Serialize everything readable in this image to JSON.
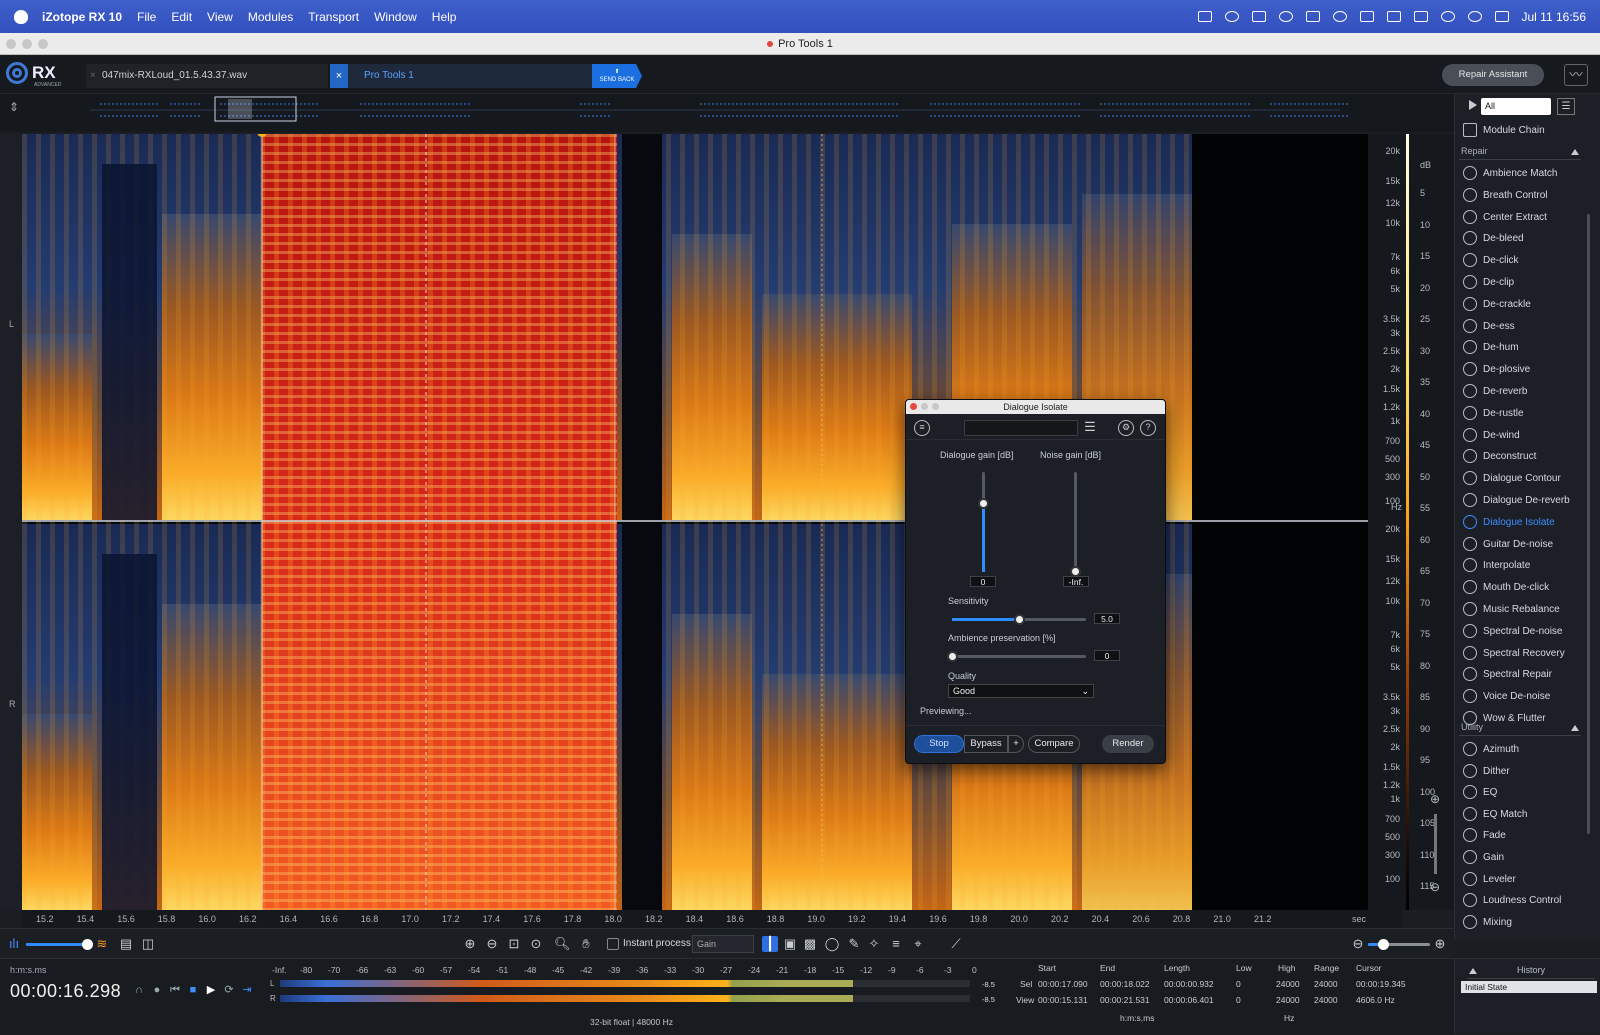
{
  "menubar": {
    "app": "iZotope RX 10",
    "items": [
      "File",
      "Edit",
      "View",
      "Modules",
      "Transport",
      "Window",
      "Help"
    ],
    "clock": "Jul 11  16:56"
  },
  "window": {
    "title": "Pro Tools 1"
  },
  "tabs": {
    "file_tab": "047mix-RXLoud_01.5.43.37.wav",
    "pt_tab": "Pro Tools 1",
    "send_back": "SEND BACK",
    "close": "×"
  },
  "logo": {
    "name": "RX",
    "edition": "ADVANCED"
  },
  "repair_assistant": "Repair Assistant",
  "channels": {
    "left": "L",
    "right": "R"
  },
  "freq_axis": {
    "unit": "Hz",
    "labels": [
      "20k",
      "15k",
      "12k",
      "10k",
      "7k",
      "6k",
      "5k",
      "3.5k",
      "3k",
      "2.5k",
      "2k",
      "1.5k",
      "1.2k",
      "1k",
      "700",
      "500",
      "300",
      "100"
    ]
  },
  "db_axis": {
    "unit": "dB",
    "labels": [
      "5",
      "10",
      "15",
      "20",
      "25",
      "30",
      "35",
      "40",
      "45",
      "50",
      "55",
      "60",
      "65",
      "70",
      "75",
      "80",
      "85",
      "90",
      "95",
      "100",
      "105",
      "110",
      "115"
    ]
  },
  "time_axis": {
    "unit": "sec",
    "labels": [
      "15.2",
      "15.4",
      "15.6",
      "15.8",
      "16.0",
      "16.2",
      "16.4",
      "16.6",
      "16.8",
      "17.0",
      "17.2",
      "17.4",
      "17.6",
      "17.8",
      "18.0",
      "18.2",
      "18.4",
      "18.6",
      "18.8",
      "19.0",
      "19.2",
      "19.4",
      "19.6",
      "19.8",
      "20.0",
      "20.2",
      "20.4",
      "20.6",
      "20.8",
      "21.0",
      "21.2"
    ]
  },
  "toolbar": {
    "instant_process": "Instant process",
    "gain_mode": "Gain"
  },
  "transport": {
    "format_label": "h:m:s.ms",
    "timecode": "00:00:16.298",
    "meter_scale": [
      "-Inf.",
      "-80",
      "-70",
      "-66",
      "-63",
      "-60",
      "-57",
      "-54",
      "-51",
      "-48",
      "-45",
      "-42",
      "-39",
      "-36",
      "-33",
      "-30",
      "-27",
      "-24",
      "-21",
      "-18",
      "-15",
      "-12",
      "-9",
      "-6",
      "-3",
      "0"
    ],
    "left_peak": "-8.5",
    "right_peak": "-8.5",
    "left_level": 0.83,
    "right_level": 0.83,
    "format": "32-bit float | 48000 Hz"
  },
  "selection": {
    "headers": [
      "Start",
      "End",
      "Length",
      "Low",
      "High",
      "Range",
      "Cursor"
    ],
    "sel_label": "Sel",
    "view_label": "View",
    "sel": [
      "00:00:17.090",
      "00:00:18.022",
      "00:00:00.932",
      "0",
      "24000",
      "24000",
      "00:00:19.345"
    ],
    "view": [
      "00:00:15.131",
      "00:00:21.531",
      "00:00:06.401",
      "0",
      "24000",
      "24000",
      "4606.0 Hz"
    ],
    "time_unit": "h:m:s.ms",
    "freq_unit": "Hz"
  },
  "module_panel": {
    "filter": "All",
    "chain": "Module Chain",
    "repair_header": "Repair",
    "repair": [
      "Ambience Match",
      "Breath Control",
      "Center Extract",
      "De-bleed",
      "De-click",
      "De-clip",
      "De-crackle",
      "De-ess",
      "De-hum",
      "De-plosive",
      "De-reverb",
      "De-rustle",
      "De-wind",
      "Deconstruct",
      "Dialogue Contour",
      "Dialogue De-reverb",
      "Dialogue Isolate",
      "Guitar De-noise",
      "Interpolate",
      "Mouth De-click",
      "Music Rebalance",
      "Spectral De-noise",
      "Spectral Recovery",
      "Spectral Repair",
      "Voice De-noise",
      "Wow & Flutter"
    ],
    "active": "Dialogue Isolate",
    "utility_header": "Utility",
    "utility": [
      "Azimuth",
      "Dither",
      "EQ",
      "EQ Match",
      "Fade",
      "Gain",
      "Leveler",
      "Loudness Control",
      "Mixing"
    ]
  },
  "history": {
    "header": "History",
    "items": [
      "Initial State"
    ]
  },
  "plugin": {
    "title": "Dialogue Isolate",
    "dialogue_gain_label": "Dialogue gain [dB]",
    "noise_gain_label": "Noise gain [dB]",
    "dialogue_gain": "0",
    "noise_gain": "-Inf.",
    "dialogue_gain_level": 0.68,
    "noise_gain_level": 0.0,
    "sensitivity_label": "Sensitivity",
    "sensitivity": "5.0",
    "sensitivity_level": 0.5,
    "ambience_label": "Ambience preservation [%]",
    "ambience": "0",
    "ambience_level": 0.0,
    "quality_label": "Quality",
    "quality": "Good",
    "status": "Previewing...",
    "buttons": {
      "stop": "Stop",
      "bypass": "Bypass",
      "plus": "+",
      "compare": "Compare",
      "render": "Render"
    }
  },
  "colors": {
    "accent": "#2f8cff",
    "selection": "#d41a12",
    "menubar": "#3a58c6"
  }
}
